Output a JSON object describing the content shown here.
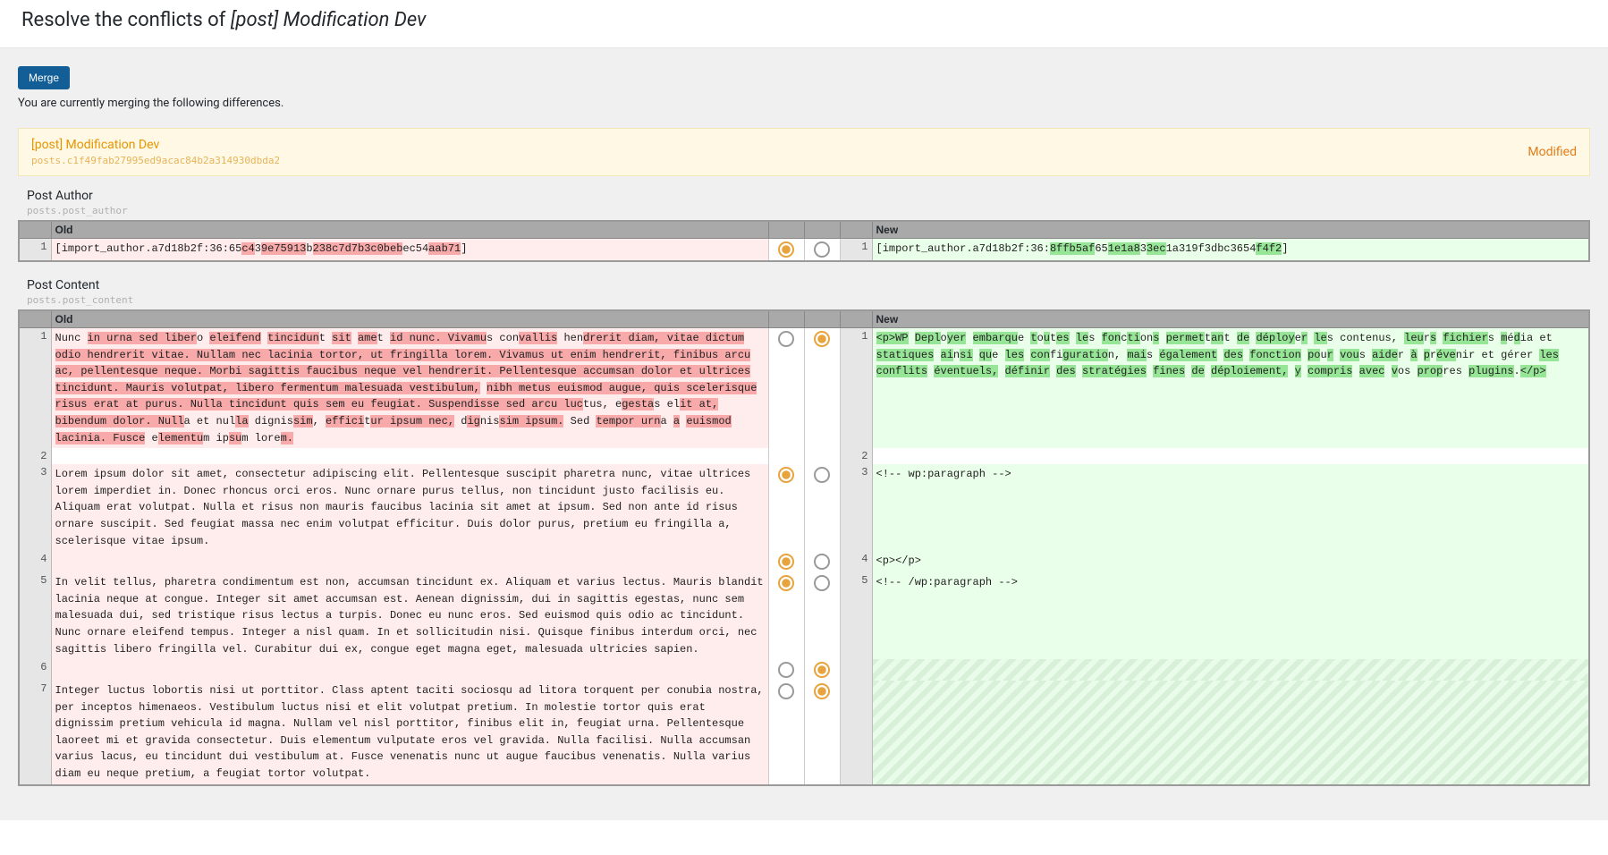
{
  "header": {
    "title_prefix": "Resolve the conflicts of ",
    "title_em": "[post] Modification Dev"
  },
  "toolbar": {
    "merge_label": "Merge"
  },
  "intro": "You are currently merging the following differences.",
  "banner": {
    "title": "[post] Modification Dev",
    "hash": "posts.c1f49fab27995ed9acac84b2a314930dbda2",
    "status": "Modified"
  },
  "sections": {
    "author": {
      "label": "Post Author",
      "sub": "posts.post_author",
      "old_head": "Old",
      "new_head": "New"
    },
    "content": {
      "label": "Post Content",
      "sub": "posts.post_content",
      "old_head": "Old",
      "new_head": "New"
    }
  },
  "author_diff": {
    "old": {
      "num": "1",
      "pre": "[import_author.a7d18b2f:36:65",
      "d1": "c4",
      "c1": "3",
      "d2": "9e75913",
      "c2": "b",
      "d3": "238c7d7b3c0beb",
      "c3": "ec54",
      "d4": "aab71",
      "post": "]"
    },
    "new": {
      "num": "1",
      "pre": "[import_author.a7d18b2f:36:",
      "i1": "8ffb5af",
      "c1": "65",
      "i2": "1e1a8",
      "c2": "3",
      "i3": "3ec",
      "c3": "1a319f3dbc36",
      "c4": "54",
      "i4": "f4f2",
      "post": "]"
    }
  },
  "content_diff": {
    "old": [
      {
        "num": "1",
        "cls": "old",
        "html": "Nunc <span class=\"del\">in urna sed liber</span>o <span class=\"del\">eleifend</span> <span class=\"del\">tincidun</span>t <span class=\"del\">sit</span> <span class=\"del\">ame</span>t <span class=\"del\">id nunc. Vivamu</span>s con<span class=\"del\">vallis</span> hen<span class=\"del\">drerit diam, vit</span><span class=\"del\">ae dictum odio hendrerit vitae. Nullam nec lacinia tortor, ut fringilla lorem. Vivamus ut enim hen</span><span class=\"del\">drerit, finibus arcu ac, pellentesque neque. Morbi sagittis faucibus neque vel hendrerit. Pellente</span><span class=\"del\">sque accumsan dolor et ultrices tincidunt. Mauris volutpat, libero fermentum malesuada vestibulum,</span> <span class=\"del\">nibh metus euismod augue, quis scelerisque risus erat at purus. Nulla tincidunt quis sem eu feugia</span><span class=\"del\">t. Suspendisse sed arcu luc</span>tus, e<span class=\"del\">gesta</span>s el<span class=\"del\">it at, bibendum dolor. Null</span>a et nul<span class=\"del\">la</span> dignis<span class=\"del\">sim</span>, <span class=\"del\">effici</span>t<span class=\"del\">ur ipsum nec,</span> d<span class=\"del\">ig</span>nis<span class=\"del\">sim ipsum.</span> Sed <span class=\"del\">tempor urn</span>a <span class=\"del\">a</span> <span class=\"del\">euismod lacinia. Fusce</span> e<span class=\"del\">lementu</span>m ip<span class=\"del\">su</span>m lore<span class=\"del\">m.</span>"
      },
      {
        "num": "2",
        "cls": "ctx",
        "html": ""
      },
      {
        "num": "3",
        "cls": "old",
        "html": "Lorem ipsum dolor sit amet, consectetur adipiscing elit. Pellentesque suscipit pharetra nunc, vitae ultrices lorem imperdiet in. Donec rhoncus orci eros. Nunc ornare purus tellus, non tincidunt justo facilisis eu. Aliquam erat volutpat. Nulla et risus non mauris faucibus lacinia sit amet at ipsum. Sed non ante id risus ornare suscipit. Sed feugiat massa nec enim volutpat efficitur. Duis dolor purus, pretium eu fringilla a, scelerisque vitae ipsum."
      },
      {
        "num": "4",
        "cls": "old",
        "html": ""
      },
      {
        "num": "5",
        "cls": "old",
        "html": "In velit tellus, pharetra condimentum est non, accumsan tincidunt ex. Aliquam et varius lectus. Mauris blandit lacinia neque at congue. Integer sit amet accumsan est. Aenean dignissim, dui in sagittis egestas, nunc sem malesuada dui, sed tristique risus lectus a turpis. Donec eu nunc eros. Sed euismod quis odio ac tincidunt. Nunc ornare eleifend tempus. Integer a nisl quam. In et sollicitudin nisi. Quisque finibus interdum orci, nec sagittis libero fringilla vel. Curabitur dui ex, congue eget magna eget, malesuada ultricies sapien."
      },
      {
        "num": "6",
        "cls": "old",
        "html": ""
      },
      {
        "num": "7",
        "cls": "old",
        "html": "Integer luctus lobortis nisi ut porttitor. Class aptent taciti sociosqu ad litora torquent per conubia nostra, per inceptos himenaeos. Vestibulum luctus nisi et elit volutpat pretium. In molestie tortor quis erat dignissim pretium vehicula id magna. Nullam vel nisl porttitor, finibus elit in, feugiat urna. Pellentesque laoreet mi et gravida consectetur. Duis elementum vulputate eros vel gravida. Nulla facilisi. Nulla accumsan varius lacus, eu tincidunt dui vestibulum at. Fusce venenatis nunc ut augue faucibus venenatis. Nulla varius diam eu neque pretium, a feugiat tortor volutpat."
      }
    ],
    "new": [
      {
        "num": "1",
        "cls": "new",
        "html": "<span class=\"ins\">&lt;p&gt;WP</span> <span class=\"ins\">Depl</span>o<span class=\"ins\">yer</span> <span class=\"ins\">embarqu</span>e <span class=\"ins\">t</span>o<span class=\"ins\">u</span>t<span class=\"ins\">es</span> <span class=\"ins\">le</span>s <span class=\"ins\">fon</span>c<span class=\"ins\">ti</span>on<span class=\"ins\">s</span> <span class=\"ins\">permet</span>t<span class=\"ins\">an</span>t <span class=\"ins\">de</span> <span class=\"ins\">déploy</span>e<span class=\"ins\">r</span> <span class=\"ins\">le</span>s contenus, <span class=\"ins\">leu</span>r<span class=\"ins\">s</span> <span class=\"ins\">fichier</span>s <span class=\"ins\">m</span>é<span class=\"ins\">d</span>ia et <span class=\"ins\">statiques</span> <span class=\"ins\">ai</span>n<span class=\"ins\">si</span> <span class=\"ins\">qu</span>e <span class=\"ins\">les</span> <span class=\"ins\">con</span>fi<span class=\"ins\">guratio</span>n, <span class=\"ins\">mai</span>s <span class=\"ins\">également</span> <span class=\"ins\">des</span> <span class=\"ins\">fonction</span> <span class=\"ins\">po</span>u<span class=\"ins\">r</span> <span class=\"ins\">vou</span>s <span class=\"ins\">aide</span>r <span class=\"ins\">à</span> <span class=\"ins\">p</span>r<span class=\"ins\">éve</span>nir et gérer <span class=\"ins\">les</span> <span class=\"ins\">conflits</span> <span class=\"ins\">éventuels,</span> <span class=\"ins\">définir</span> <span class=\"ins\">des</span> <span class=\"ins\">stratégies</span> <span class=\"ins\">fines</span> <span class=\"ins\">de</span> <span class=\"ins\">déploiement,</span> <span class=\"ins\">y</span> <span class=\"ins\">compris</span> <span class=\"ins\">avec</span> <span class=\"ins\">v</span>os <span class=\"ins\">prop</span>res <span class=\"ins\">plugins</span>.<span class=\"ins\">&lt;/p&gt;</span>"
      },
      {
        "num": "2",
        "cls": "ctx",
        "html": ""
      },
      {
        "num": "3",
        "cls": "new",
        "html": "&lt;!-- wp:paragraph --&gt;"
      },
      {
        "num": "4",
        "cls": "new",
        "html": "&lt;p&gt;&lt;/p&gt;"
      },
      {
        "num": "5",
        "cls": "new",
        "html": "&lt;!-- /wp:paragraph --&gt;"
      }
    ],
    "radios": [
      {
        "row": 0,
        "left": false,
        "right": true
      },
      {
        "row": 2,
        "left": true,
        "right": false
      },
      {
        "row": 3,
        "left": true,
        "right": false
      },
      {
        "row": 4,
        "left": true,
        "right": false
      },
      {
        "row": 5,
        "left": false,
        "right": true
      },
      {
        "row": 6,
        "left": false,
        "right": true
      }
    ]
  }
}
